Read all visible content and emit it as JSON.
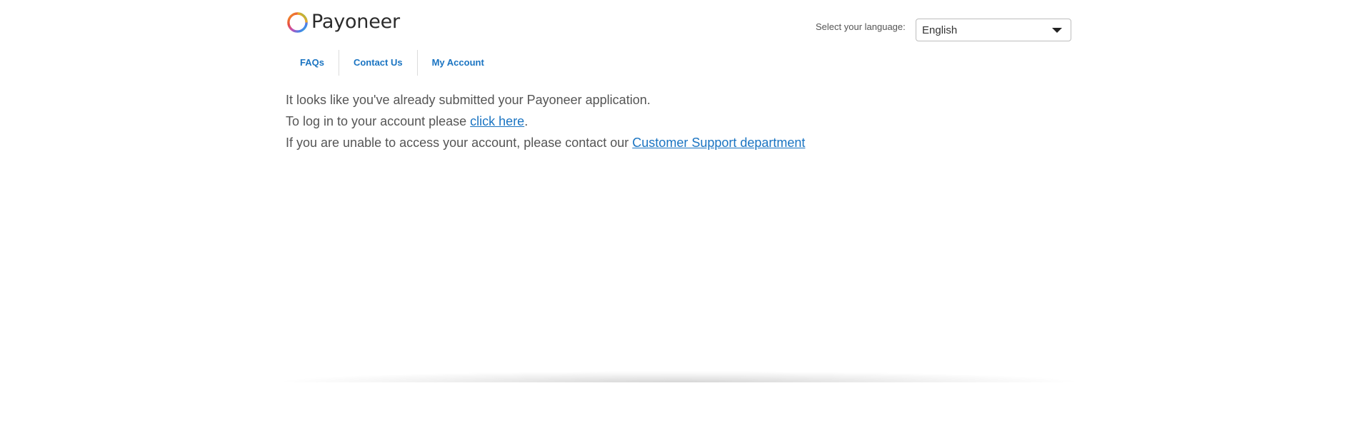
{
  "brand": {
    "name": "Payoneer",
    "ring_colors": [
      "#f5a623",
      "#e94f3c",
      "#c54fb4",
      "#4a7ee8",
      "#2cc1d9",
      "#7ac74f"
    ]
  },
  "language": {
    "label": "Select your language:",
    "selected": "English"
  },
  "nav": {
    "items": [
      {
        "label": "FAQs"
      },
      {
        "label": "Contact Us"
      },
      {
        "label": "My Account"
      }
    ]
  },
  "messages": {
    "line1": "It looks like you've already submitted your Payoneer application.",
    "line2_prefix": "To log in to your account please ",
    "line2_link": "click here",
    "line2_suffix": ".",
    "line3_prefix": "If you are unable to access your account, please contact our ",
    "line3_link": "Customer Support department"
  },
  "colors": {
    "link": "#1a74c2",
    "text": "#555555"
  }
}
